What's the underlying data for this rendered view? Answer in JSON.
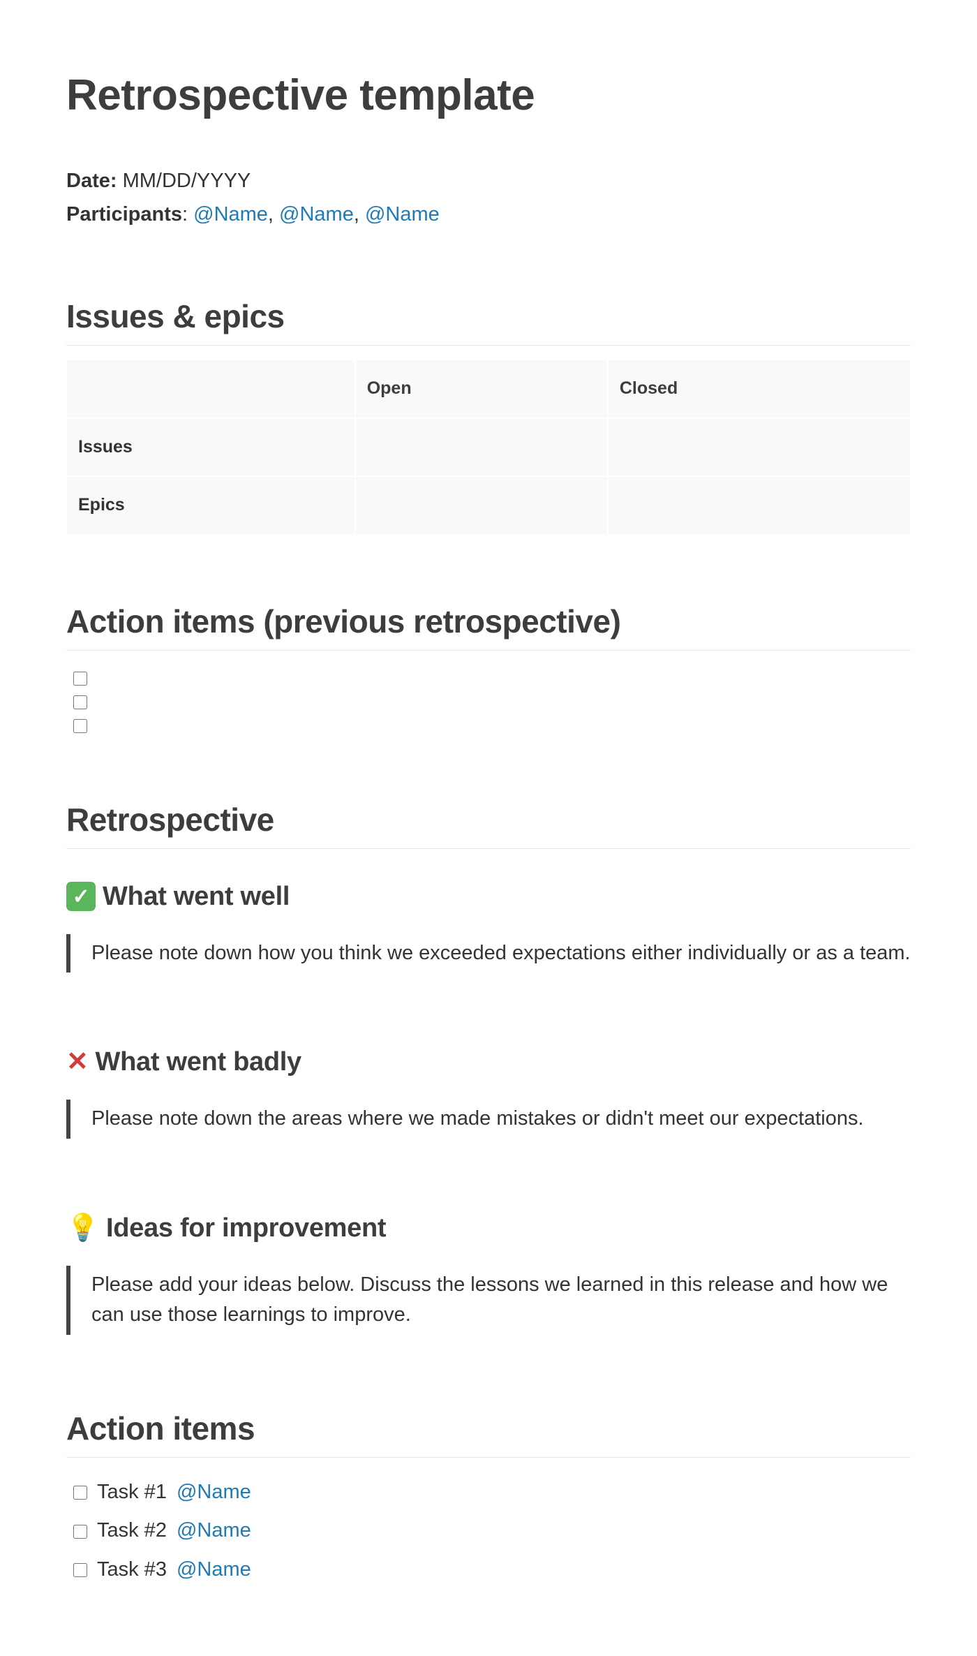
{
  "title": "Retrospective template",
  "meta": {
    "date_label": "Date:",
    "date_value": "MM/DD/YYYY",
    "participants_label": "Participants",
    "participants": [
      "@Name",
      "@Name",
      "@Name"
    ]
  },
  "sections": {
    "issues_epics": {
      "heading": "Issues & epics",
      "col_open": "Open",
      "col_closed": "Closed",
      "row_issues": "Issues",
      "row_epics": "Epics"
    },
    "prev_actions": {
      "heading": "Action items (previous retrospective)",
      "items": [
        "",
        "",
        ""
      ]
    },
    "retrospective": {
      "heading": "Retrospective",
      "went_well": {
        "heading": "What went well",
        "note": "Please note down how you think we exceeded expectations either individually or as a team."
      },
      "went_badly": {
        "heading": "What went badly",
        "note": "Please note down the areas where we made mistakes or didn't meet our expectations."
      },
      "ideas": {
        "heading": "Ideas for improvement",
        "note": "Please add your ideas below. Discuss the lessons we learned in this release and how we can use those learnings to improve."
      }
    },
    "action_items": {
      "heading": "Action items",
      "items": [
        {
          "task": "Task #1",
          "mention": "@Name"
        },
        {
          "task": "Task #2",
          "mention": "@Name"
        },
        {
          "task": "Task #3",
          "mention": "@Name"
        }
      ]
    }
  }
}
